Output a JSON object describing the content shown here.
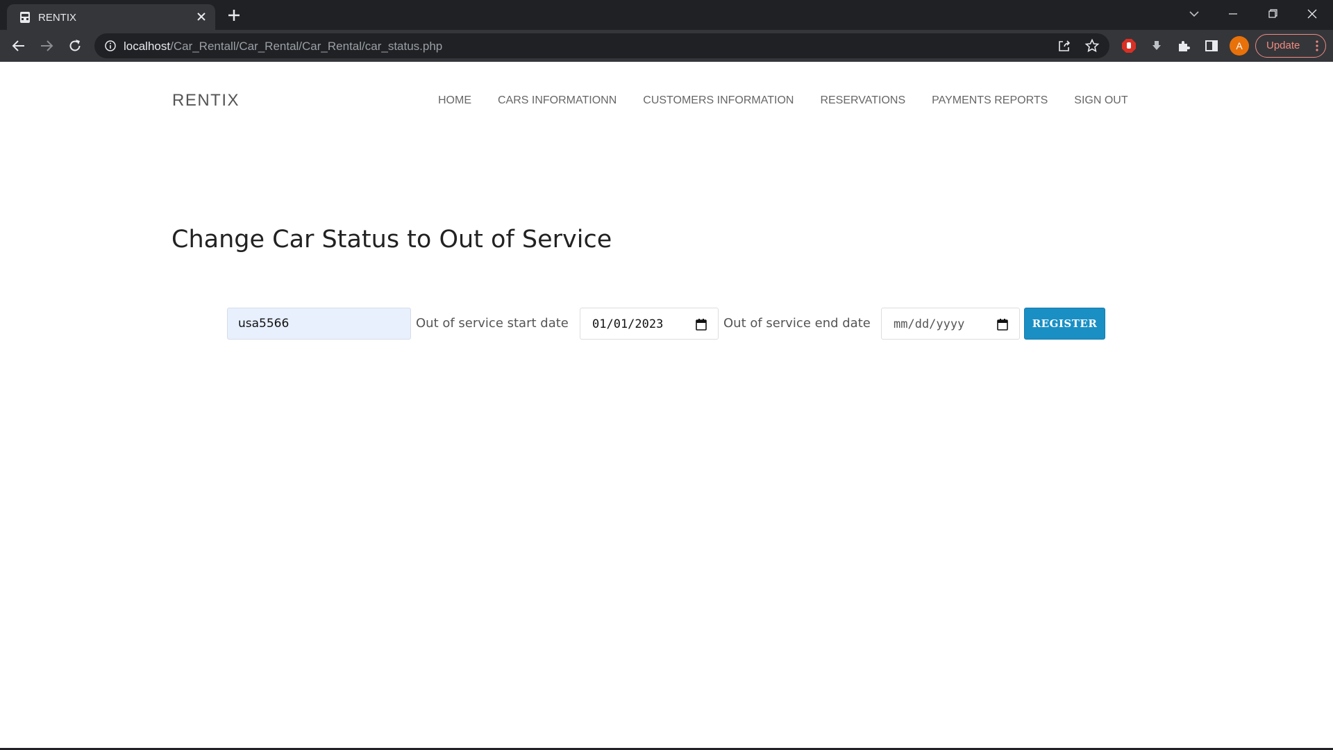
{
  "browser": {
    "tab_title": "RENTIX",
    "url_host": "localhost",
    "url_path": "/Car_Rentall/Car_Rental/Car_Rental/car_status.php",
    "avatar_letter": "A",
    "update_label": "Update"
  },
  "header": {
    "brand": "RENTIX",
    "nav": [
      "HOME",
      "CARS INFORMATIONN",
      "CUSTOMERS INFORMATION",
      "RESERVATIONS",
      "PAYMENTS REPORTS",
      "SIGN OUT"
    ]
  },
  "main": {
    "title": "Change Car Status to Out of Service",
    "form": {
      "car_value": "usa5566",
      "start_label": "Out of service start date",
      "start_value": "01/01/2023",
      "end_label": "Out of service end date",
      "end_placeholder": "mm/dd/yyyy",
      "submit_label": "REGISTER"
    }
  },
  "colors": {
    "accent": "#1a8fc4",
    "chrome_dark": "#202124",
    "chrome_toolbar": "#35363a",
    "autofill_bg": "#e8f0fe"
  }
}
